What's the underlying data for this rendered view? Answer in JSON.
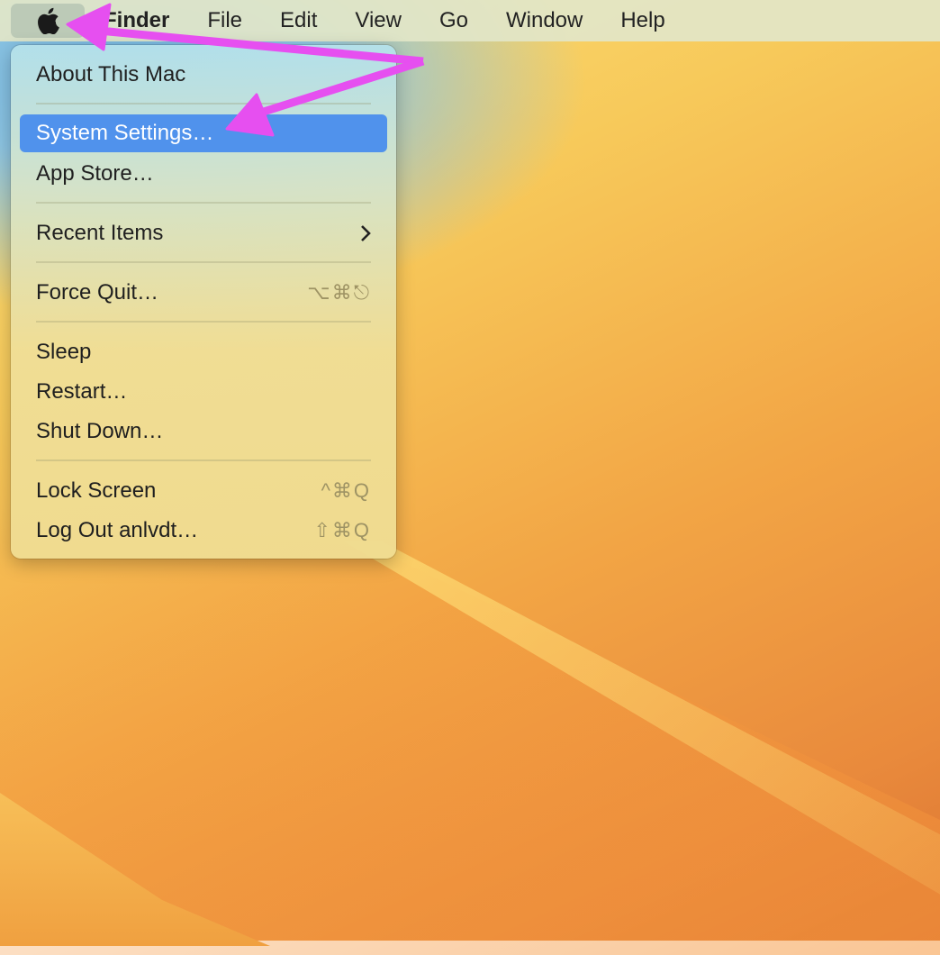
{
  "menubar": {
    "apple_icon": "apple-logo-icon",
    "items": [
      "Finder",
      "File",
      "Edit",
      "View",
      "Go",
      "Window",
      "Help"
    ]
  },
  "apple_menu": {
    "about": "About This Mac",
    "settings": "System Settings…",
    "app_store": "App Store…",
    "recent": "Recent Items",
    "force_quit": "Force Quit…",
    "force_quit_shortcut": "⌥⌘⎋",
    "sleep": "Sleep",
    "restart": "Restart…",
    "shutdown": "Shut Down…",
    "lock": "Lock Screen",
    "lock_shortcut": "^⌘Q",
    "logout": "Log Out anlvdt…",
    "logout_shortcut": "⇧⌘Q"
  },
  "colors": {
    "highlight": "#5092ec",
    "annotation_arrow": "#e64ff0"
  }
}
